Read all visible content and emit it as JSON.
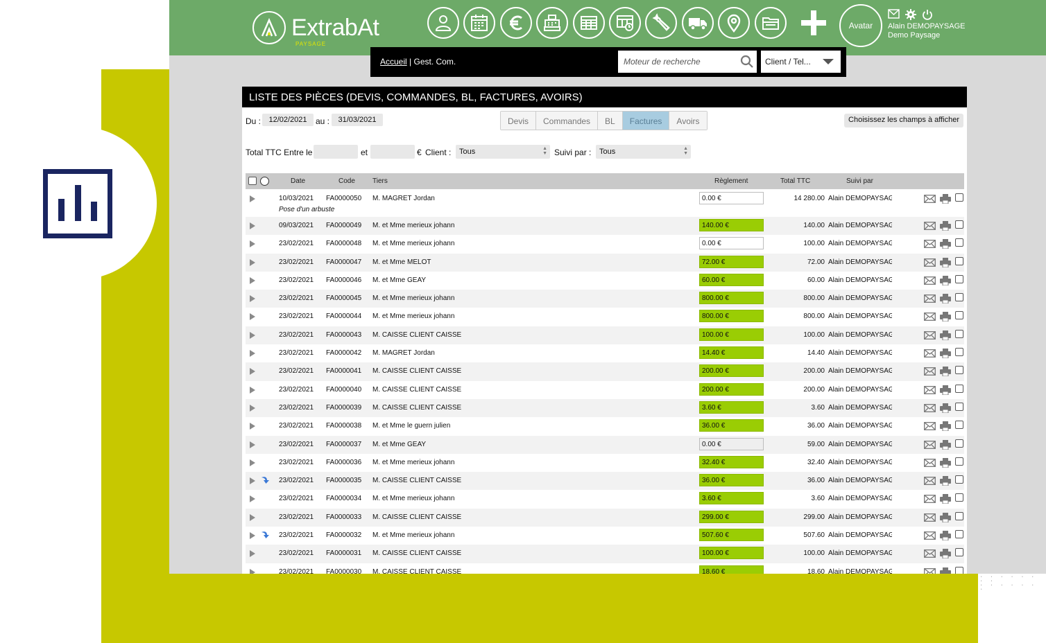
{
  "brand": {
    "name": "ExtrabAt",
    "sub": "PAYSAGE"
  },
  "topbar": {
    "icons": [
      "contacts-icon",
      "calendar-icon",
      "euro-icon",
      "cash-register-icon",
      "spreadsheet-icon",
      "planning-icon",
      "wrench-icon",
      "truck-icon",
      "location-pin-icon",
      "folder-icon"
    ],
    "avatar_label": "Avatar",
    "user_name": "Alain DEMOPAYSAGE",
    "company": "Demo Paysage"
  },
  "nav": {
    "home": "Accueil",
    "separator": "|",
    "current": "Gest. Com.",
    "search_placeholder": "Moteur de recherche",
    "scope_value": "Client / Tel..."
  },
  "page": {
    "title": "LISTE DES PIÈCES (DEVIS, COMMANDES, BL, FACTURES, AVOIRS)",
    "du_label": "Du :",
    "date_from": "12/02/2021",
    "au_label": "au :",
    "date_to": "31/03/2021",
    "tabs": [
      {
        "label": "Devis",
        "active": false
      },
      {
        "label": "Commandes",
        "active": false
      },
      {
        "label": "BL",
        "active": false
      },
      {
        "label": "Factures",
        "active": true
      },
      {
        "label": "Avoirs",
        "active": false
      }
    ],
    "fields_button": "Choisissez les champs à afficher",
    "total_label": "Total TTC Entre le",
    "et_label": "et",
    "euro_label": "€",
    "client_label": "Client :",
    "client_value": "Tous",
    "suivi_label": "Suivi par :",
    "suivi_value": "Tous"
  },
  "table": {
    "columns": {
      "date": "Date",
      "code": "Code",
      "tiers": "Tiers",
      "reglement": "Règlement",
      "total": "Total TTC",
      "suivi": "Suivi par"
    },
    "rows": [
      {
        "date": "10/03/2021",
        "code": "FA0000050",
        "tiers": "M. MAGRET Jordan",
        "reglement": "0.00 €",
        "status": "unpaid",
        "total": "14 280.00",
        "suivi": "Alain DEMOPAYSAGE",
        "note": "Pose d'un arbuste",
        "arrow": false
      },
      {
        "date": "09/03/2021",
        "code": "FA0000049",
        "tiers": "M. et Mme merieux johann",
        "reglement": "140.00 €",
        "status": "paid",
        "total": "140.00",
        "suivi": "Alain DEMOPAYSAGE",
        "arrow": false
      },
      {
        "date": "23/02/2021",
        "code": "FA0000048",
        "tiers": "M. et Mme merieux johann",
        "reglement": "0.00 €",
        "status": "unpaid",
        "total": "100.00",
        "suivi": "Alain DEMOPAYSAGE",
        "arrow": false
      },
      {
        "date": "23/02/2021",
        "code": "FA0000047",
        "tiers": "M. et Mme MELOT",
        "reglement": "72.00 €",
        "status": "paid",
        "total": "72.00",
        "suivi": "Alain DEMOPAYSAGE",
        "arrow": false
      },
      {
        "date": "23/02/2021",
        "code": "FA0000046",
        "tiers": "M. et Mme GEAY",
        "reglement": "60.00 €",
        "status": "paid",
        "total": "60.00",
        "suivi": "Alain DEMOPAYSAGE",
        "arrow": false
      },
      {
        "date": "23/02/2021",
        "code": "FA0000045",
        "tiers": "M. et Mme merieux johann",
        "reglement": "800.00 €",
        "status": "paid",
        "total": "800.00",
        "suivi": "Alain DEMOPAYSAGE",
        "arrow": false
      },
      {
        "date": "23/02/2021",
        "code": "FA0000044",
        "tiers": "M. et Mme merieux johann",
        "reglement": "800.00 €",
        "status": "paid",
        "total": "800.00",
        "suivi": "Alain DEMOPAYSAGE",
        "arrow": false
      },
      {
        "date": "23/02/2021",
        "code": "FA0000043",
        "tiers": "M. CAISSE CLIENT CAISSE",
        "reglement": "100.00 €",
        "status": "paid",
        "total": "100.00",
        "suivi": "Alain DEMOPAYSAGE",
        "arrow": false
      },
      {
        "date": "23/02/2021",
        "code": "FA0000042",
        "tiers": "M. MAGRET Jordan",
        "reglement": "14.40 €",
        "status": "paid",
        "total": "14.40",
        "suivi": "Alain DEMOPAYSAGE",
        "arrow": false
      },
      {
        "date": "23/02/2021",
        "code": "FA0000041",
        "tiers": "M. CAISSE CLIENT CAISSE",
        "reglement": "200.00 €",
        "status": "paid",
        "total": "200.00",
        "suivi": "Alain DEMOPAYSAGE",
        "arrow": false
      },
      {
        "date": "23/02/2021",
        "code": "FA0000040",
        "tiers": "M. CAISSE CLIENT CAISSE",
        "reglement": "200.00 €",
        "status": "paid",
        "total": "200.00",
        "suivi": "Alain DEMOPAYSAGE",
        "arrow": false
      },
      {
        "date": "23/02/2021",
        "code": "FA0000039",
        "tiers": "M. CAISSE CLIENT CAISSE",
        "reglement": "3.60 €",
        "status": "paid",
        "total": "3.60",
        "suivi": "Alain DEMOPAYSAGE",
        "arrow": false
      },
      {
        "date": "23/02/2021",
        "code": "FA0000038",
        "tiers": "M. et Mme le guern julien",
        "reglement": "36.00 €",
        "status": "paid",
        "total": "36.00",
        "suivi": "Alain DEMOPAYSAGE",
        "arrow": false
      },
      {
        "date": "23/02/2021",
        "code": "FA0000037",
        "tiers": "M. et Mme GEAY",
        "reglement": "0.00 €",
        "status": "grey",
        "total": "59.00",
        "suivi": "Alain DEMOPAYSAGE",
        "arrow": false
      },
      {
        "date": "23/02/2021",
        "code": "FA0000036",
        "tiers": "M. et Mme merieux johann",
        "reglement": "32.40 €",
        "status": "paid",
        "total": "32.40",
        "suivi": "Alain DEMOPAYSAGE",
        "arrow": false
      },
      {
        "date": "23/02/2021",
        "code": "FA0000035",
        "tiers": "M. CAISSE CLIENT CAISSE",
        "reglement": "36.00 €",
        "status": "paid",
        "total": "36.00",
        "suivi": "Alain DEMOPAYSAGE",
        "arrow": true
      },
      {
        "date": "23/02/2021",
        "code": "FA0000034",
        "tiers": "M. et Mme merieux johann",
        "reglement": "3.60 €",
        "status": "paid",
        "total": "3.60",
        "suivi": "Alain DEMOPAYSAGE",
        "arrow": false
      },
      {
        "date": "23/02/2021",
        "code": "FA0000033",
        "tiers": "M. CAISSE CLIENT CAISSE",
        "reglement": "299.00 €",
        "status": "paid",
        "total": "299.00",
        "suivi": "Alain DEMOPAYSAGE",
        "arrow": false
      },
      {
        "date": "23/02/2021",
        "code": "FA0000032",
        "tiers": "M. et Mme merieux johann",
        "reglement": "507.60 €",
        "status": "paid",
        "total": "507.60",
        "suivi": "Alain DEMOPAYSAGE",
        "arrow": true
      },
      {
        "date": "23/02/2021",
        "code": "FA0000031",
        "tiers": "M. CAISSE CLIENT CAISSE",
        "reglement": "100.00 €",
        "status": "paid",
        "total": "100.00",
        "suivi": "Alain DEMOPAYSAGE",
        "arrow": false
      },
      {
        "date": "23/02/2021",
        "code": "FA0000030",
        "tiers": "M. CAISSE CLIENT CAISSE",
        "reglement": "18.60 €",
        "status": "paid",
        "total": "18.60",
        "suivi": "Alain DEMOPAYSAGE",
        "arrow": false
      }
    ]
  },
  "colors": {
    "topbar": "#6daa68",
    "olive": "#c7c800",
    "paid": "#9acd04",
    "tab_active": "#a8cce0",
    "navy": "#1a2560"
  }
}
